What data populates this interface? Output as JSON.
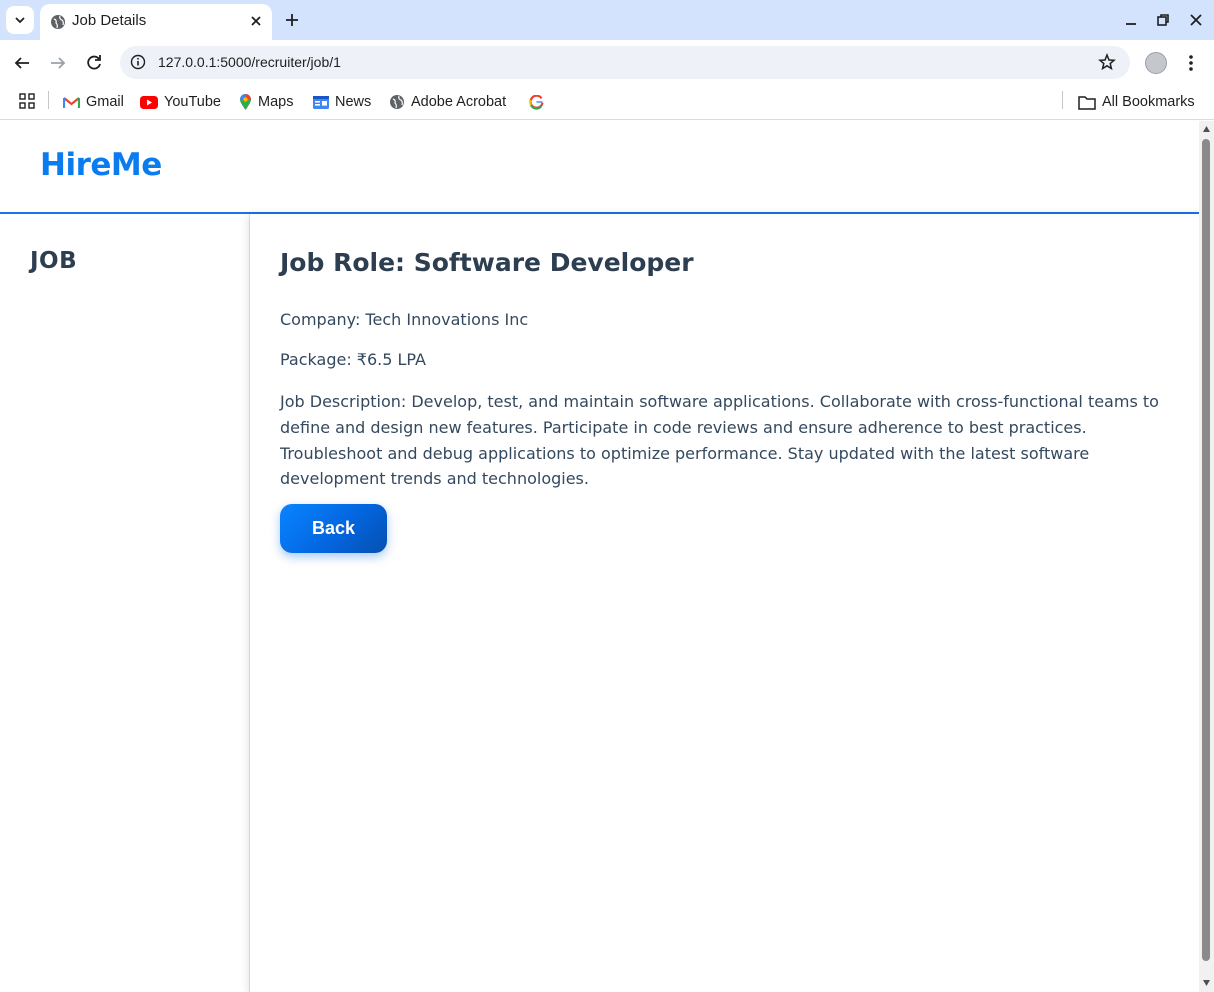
{
  "browser": {
    "tab_title": "Job Details",
    "url": "127.0.0.1:5000/recruiter/job/1",
    "bookmarks": [
      {
        "label": "Gmail",
        "icon": "gmail-icon"
      },
      {
        "label": "YouTube",
        "icon": "youtube-icon"
      },
      {
        "label": "Maps",
        "icon": "maps-icon"
      },
      {
        "label": "News",
        "icon": "news-icon"
      },
      {
        "label": "Adobe Acrobat",
        "icon": "globe-icon"
      },
      {
        "label": "",
        "icon": "google-icon"
      }
    ],
    "all_bookmarks": "All Bookmarks"
  },
  "site": {
    "logo": "HireMe"
  },
  "sidebar": {
    "title": "JOB"
  },
  "job": {
    "title": "Job Role: Software Developer",
    "company": "Company: Tech Innovations Inc",
    "package": "Package: ₹6.5 LPA",
    "description": "Job Description: Develop, test, and maintain software applications. Collaborate with cross-functional teams to define and design new features. Participate in code reviews and ensure adherence to best practices. Troubleshoot and debug applications to optimize performance. Stay updated with the latest software development trends and technologies.",
    "back_label": "Back"
  },
  "colors": {
    "brand": "#0a7cf0",
    "header_rule": "#1a73e8",
    "heading": "#2c3e50",
    "body_text": "#34495e",
    "tabstrip": "#d3e3fd"
  }
}
